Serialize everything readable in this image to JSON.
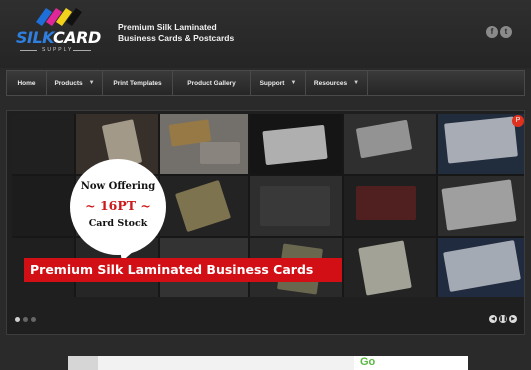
{
  "logo": {
    "word_silk": "SILK",
    "word_card": "CARD",
    "sub": "SUPPLY"
  },
  "tagline": {
    "line1": "Premium Silk Laminated",
    "line2": "Business Cards & Postcards"
  },
  "social": [
    {
      "icon": "facebook-icon",
      "glyph": "f"
    },
    {
      "icon": "twitter-icon",
      "glyph": "t"
    }
  ],
  "nav": [
    {
      "label": "Home",
      "has_menu": false
    },
    {
      "label": "Products",
      "has_menu": true
    },
    {
      "label": "Print Templates",
      "has_menu": false
    },
    {
      "label": "Product Gallery",
      "has_menu": false
    },
    {
      "label": "Support",
      "has_menu": true
    },
    {
      "label": "Resources",
      "has_menu": true
    }
  ],
  "hero": {
    "bubble": {
      "line1": "Now Offering",
      "line2": "~ 16PT ~",
      "line3": "Card Stock"
    },
    "banner": "Premium Silk Laminated Business Cards",
    "slides": 3,
    "active_slide": 1
  },
  "colors": {
    "accent_blue": "#2f7fe0",
    "banner_red": "#d10f14",
    "bg": "#2a2a2a",
    "bottom_green": "#5ab843"
  }
}
